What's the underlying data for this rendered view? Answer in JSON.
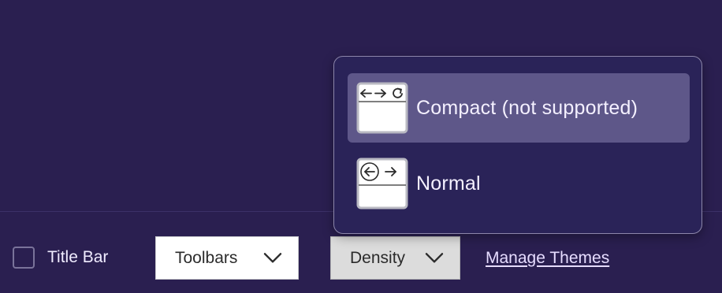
{
  "footer": {
    "title_bar_label": "Title Bar",
    "title_bar_checked": false,
    "toolbars_label": "Toolbars",
    "density_label": "Density",
    "manage_themes_label": "Manage Themes"
  },
  "density_menu": {
    "items": [
      {
        "label": "Compact (not supported)",
        "icon": "compact-density-icon",
        "highlighted": true
      },
      {
        "label": "Normal",
        "icon": "normal-density-icon",
        "highlighted": false
      }
    ]
  },
  "colors": {
    "background": "#2a1f50",
    "panel": "#2a2358",
    "highlight": "#5e5789",
    "text": "#f0ecff"
  }
}
